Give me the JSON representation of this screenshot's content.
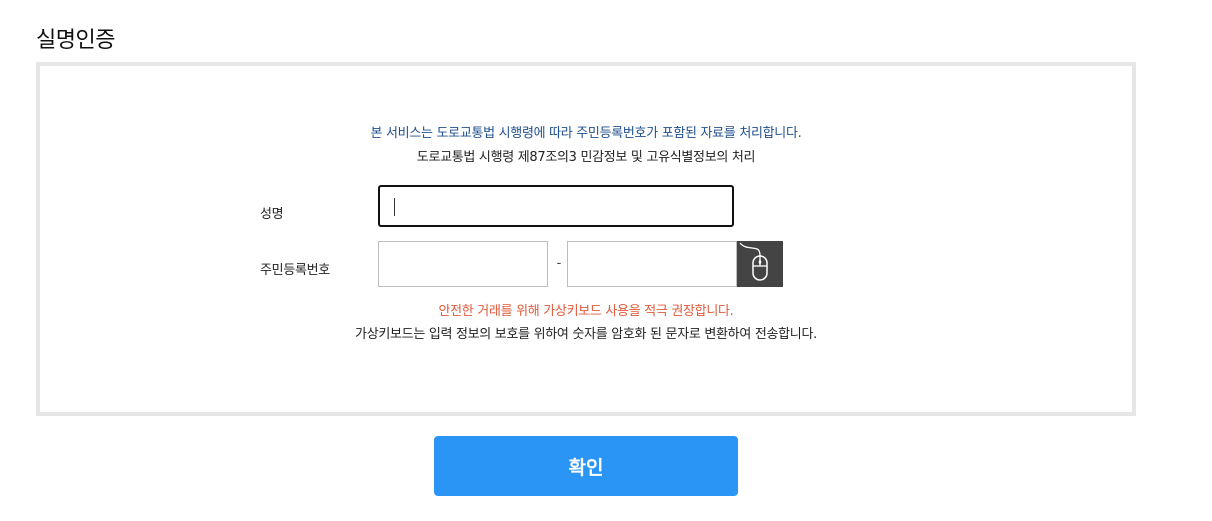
{
  "page": {
    "title": "실명인증"
  },
  "notice": {
    "line1": "본 서비스는 도로교통법 시행령에 따라 주민등록번호가 포함된 자료를 처리합니다.",
    "line2": "도로교통법 시행령 제87조의3 민감정보 및 고유식별정보의 처리"
  },
  "form": {
    "name_label": "성명",
    "name_value": "",
    "rrn_label": "주민등록번호",
    "rrn_front_value": "",
    "rrn_separator": "-",
    "rrn_back_value": "",
    "virtual_keyboard_icon": "mouse-icon"
  },
  "warning": {
    "line1": "안전한 거래를 위해 가상키보드 사용을 적극 권장합니다.",
    "line2": "가상키보드는 입력 정보의 보호를 위하여 숫자를 암호화 된 문자로 변환하여 전송합니다."
  },
  "actions": {
    "confirm_label": "확인"
  },
  "colors": {
    "notice_blue": "#1f4f8f",
    "warning_red": "#e15a3a",
    "button_blue": "#2b95f5",
    "panel_border": "#e6e6e6",
    "keyboard_button": "#444444"
  }
}
